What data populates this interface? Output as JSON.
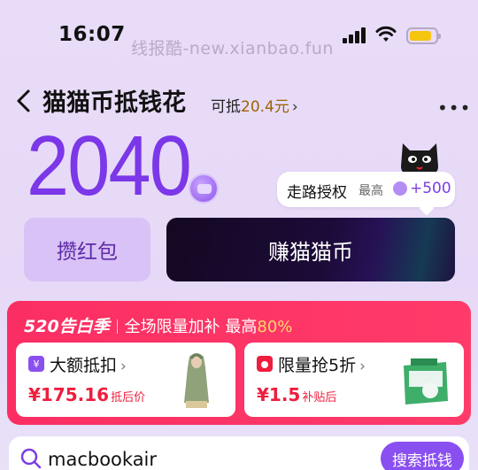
{
  "status_bar": {
    "time": "16:07",
    "battery_level": 0.85,
    "battery_color": "#f6c50f"
  },
  "watermark": "线报酷-new.xianbao.fun",
  "nav": {
    "title": "猫猫币抵钱花",
    "deduct_prefix": "可抵",
    "deduct_amount": "20.4元",
    "more_icon": "more-dots-icon",
    "back_icon": "back-chevron-icon"
  },
  "balance": {
    "value": "2040",
    "color": "#7b37e8"
  },
  "tooltip": {
    "action": "走路授权",
    "max_label": "最高",
    "bonus": "+500"
  },
  "buttons": {
    "red_packet": "攒红包",
    "earn": "赚猫猫币"
  },
  "promo": {
    "season": "520告白季",
    "slogan": "全场限量加补 最高",
    "percent": "80%",
    "items": [
      {
        "title": "大额抵扣",
        "price": "¥175.16",
        "price_note": "抵后价",
        "icon": "coupon-icon",
        "image": "clothing-model-image"
      },
      {
        "title": "限量抢5折",
        "price": "¥1.5",
        "price_note": "补贴后",
        "icon": "flash-sale-icon",
        "image": "detergent-product-image"
      }
    ]
  },
  "search": {
    "value": "macbookair",
    "button": "搜索抵钱"
  },
  "colors": {
    "accent": "#8a4ff0",
    "promo_red": "#fb2e63",
    "price_red": "#ee1e3e"
  }
}
